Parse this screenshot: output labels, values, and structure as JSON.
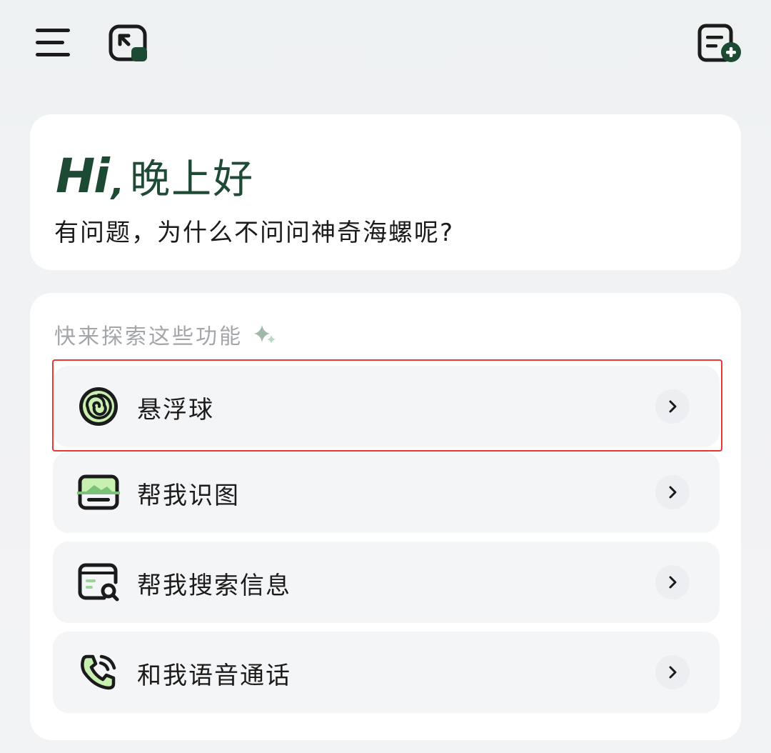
{
  "header": {
    "menu_icon": "menu-icon",
    "fold_icon": "floating-window-icon",
    "new_chat_icon": "new-chat-icon"
  },
  "greeting": {
    "hi": "Hi",
    "comma": ",",
    "salutation": "晚上好",
    "subtitle": "有问题，为什么不问问神奇海螺呢?"
  },
  "features": {
    "heading": "快来探索这些功能",
    "items": [
      {
        "label": "悬浮球",
        "icon": "floating-ball-icon",
        "selected": true
      },
      {
        "label": "帮我识图",
        "icon": "image-recognition-icon",
        "selected": false
      },
      {
        "label": "帮我搜索信息",
        "icon": "search-info-icon",
        "selected": false
      },
      {
        "label": "和我语音通话",
        "icon": "voice-call-icon",
        "selected": false
      }
    ]
  },
  "colors": {
    "brand_dark_green": "#1d4a33",
    "accent_green": "#c8f0b0",
    "selection_outline": "#e53a36"
  }
}
